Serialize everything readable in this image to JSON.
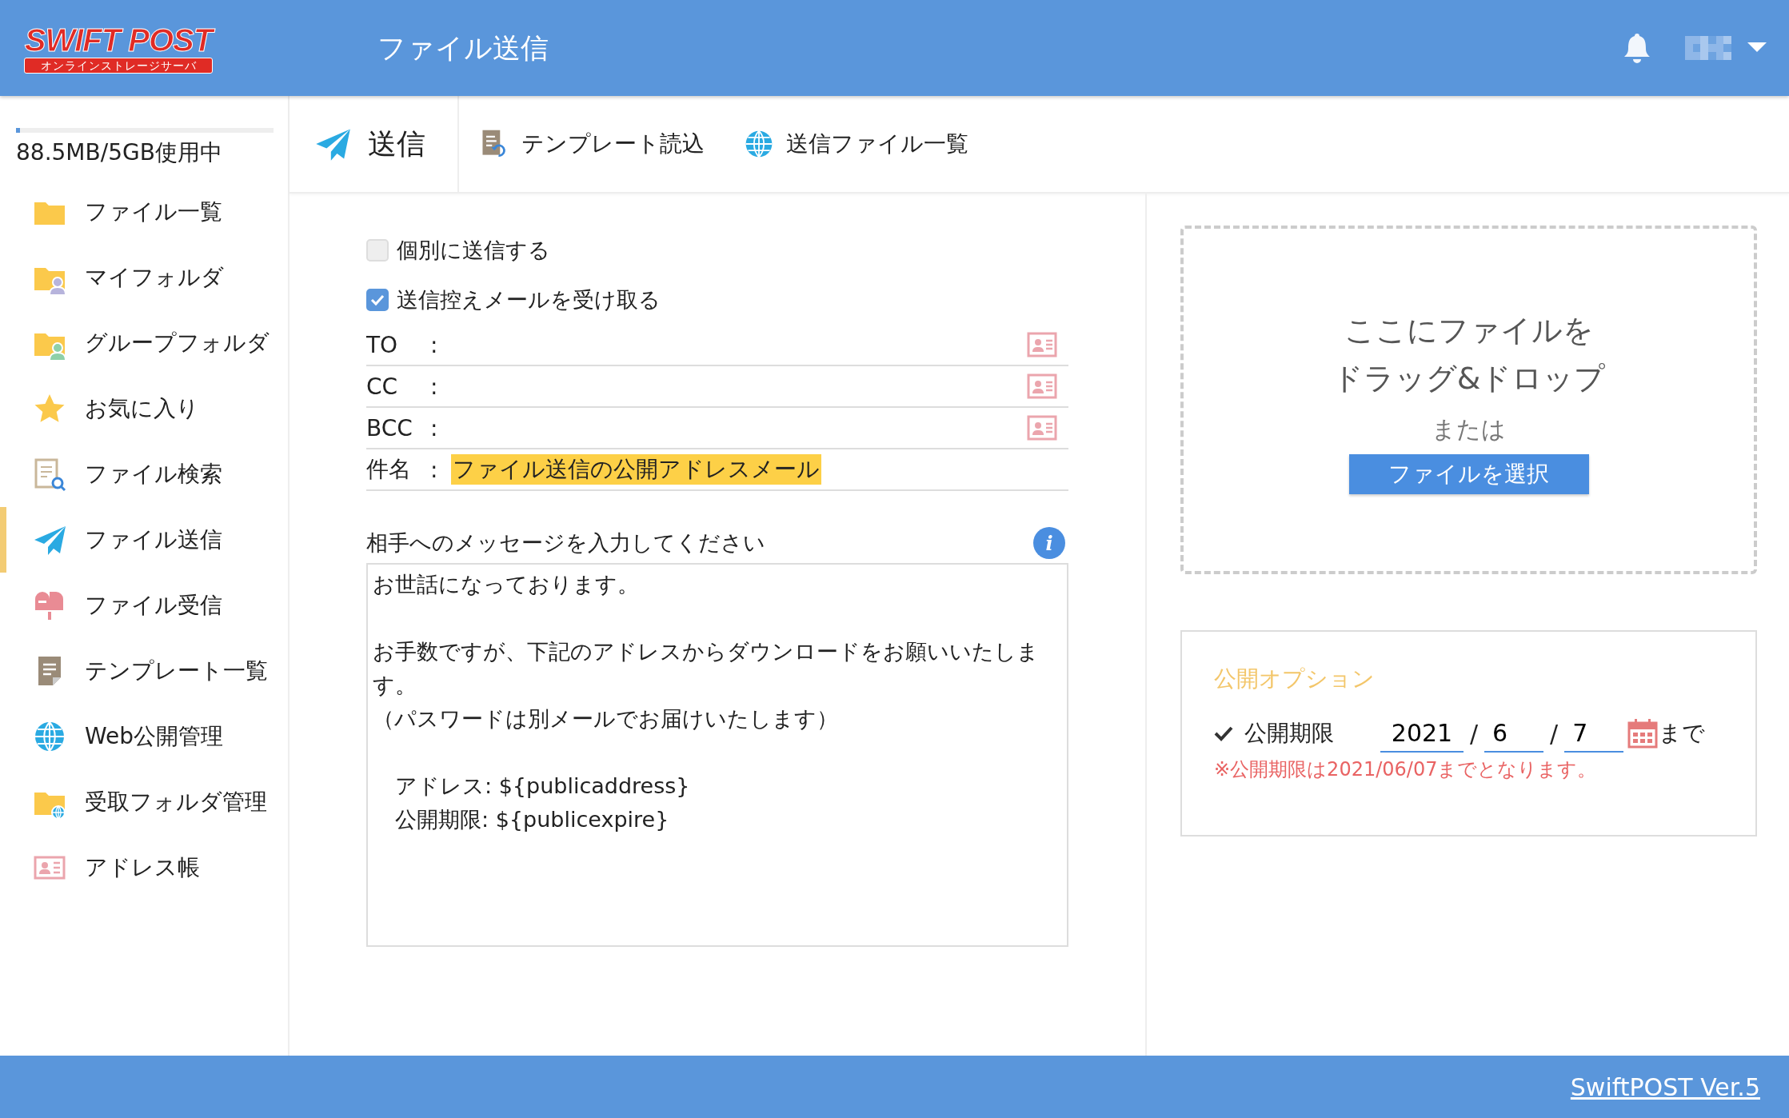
{
  "header": {
    "logo": {
      "title": "SWIFT POST",
      "subtitle": "オンラインストレージサーバ"
    },
    "title": "ファイル送信"
  },
  "sidebar": {
    "storage": {
      "level": 0.006,
      "label": "88.5MB/5GB使用中"
    },
    "items": [
      {
        "kind": "folder",
        "label": "ファイル一覧",
        "selected": false
      },
      {
        "kind": "my-folder",
        "label": "マイフォルダ",
        "selected": false
      },
      {
        "kind": "group-folder",
        "label": "グループフォルダ",
        "selected": false
      },
      {
        "kind": "star",
        "label": "お気に入り",
        "selected": false
      },
      {
        "kind": "search",
        "label": "ファイル検索",
        "selected": false
      },
      {
        "kind": "send",
        "label": "ファイル送信",
        "selected": true
      },
      {
        "kind": "mailbox",
        "label": "ファイル受信",
        "selected": false
      },
      {
        "kind": "template",
        "label": "テンプレート一覧",
        "selected": false
      },
      {
        "kind": "globe",
        "label": "Web公開管理",
        "selected": false
      },
      {
        "kind": "web-folder",
        "label": "受取フォルダ管理",
        "selected": false
      },
      {
        "kind": "address",
        "label": "アドレス帳",
        "selected": false
      }
    ]
  },
  "toolbar": [
    {
      "kind": "send",
      "label": "送信"
    },
    {
      "kind": "template",
      "label": "テンプレート読込"
    },
    {
      "kind": "globe",
      "label": "送信ファイル一覧"
    }
  ],
  "form": {
    "options": [
      {
        "label": "個別に送信する",
        "checked": false
      },
      {
        "label": "送信控えメールを受け取る",
        "checked": true
      }
    ],
    "recipients": [
      {
        "label": "TO",
        "separator": ":"
      },
      {
        "label": "CC",
        "separator": ":"
      },
      {
        "label": "BCC",
        "separator": ":"
      }
    ],
    "subject": {
      "label": "件名",
      "separator": ":",
      "value": "ファイル送信の公開アドレスメール"
    },
    "message": {
      "label": "相手へのメッセージを入力してください",
      "info": "i",
      "paragraphs": [
        [
          "お世話になっております。"
        ],
        [
          "お手数ですが、下記のアドレスからダウンロードをお願いいたします。",
          "（パスワードは別メールでお届けいたします）"
        ],
        [
          "アドレス: ${publicaddress}",
          "公開期限: ${publicexpire}"
        ]
      ]
    }
  },
  "dropzone": {
    "lines": [
      "ここにファイルを",
      "ドラッグ&ドロップ"
    ],
    "or": "または",
    "button": "ファイルを選択"
  },
  "publish_options": {
    "title": "公開オプション",
    "expiry": {
      "checked": true,
      "label": "公開期限",
      "year": "2021",
      "sep1": "/",
      "month": "6",
      "sep2": "/",
      "day": "7",
      "suffix": "まで",
      "note": "※公開期限は2021/06/07までとなります。"
    }
  },
  "footer": {
    "version": "SwiftPOST Ver.5"
  }
}
